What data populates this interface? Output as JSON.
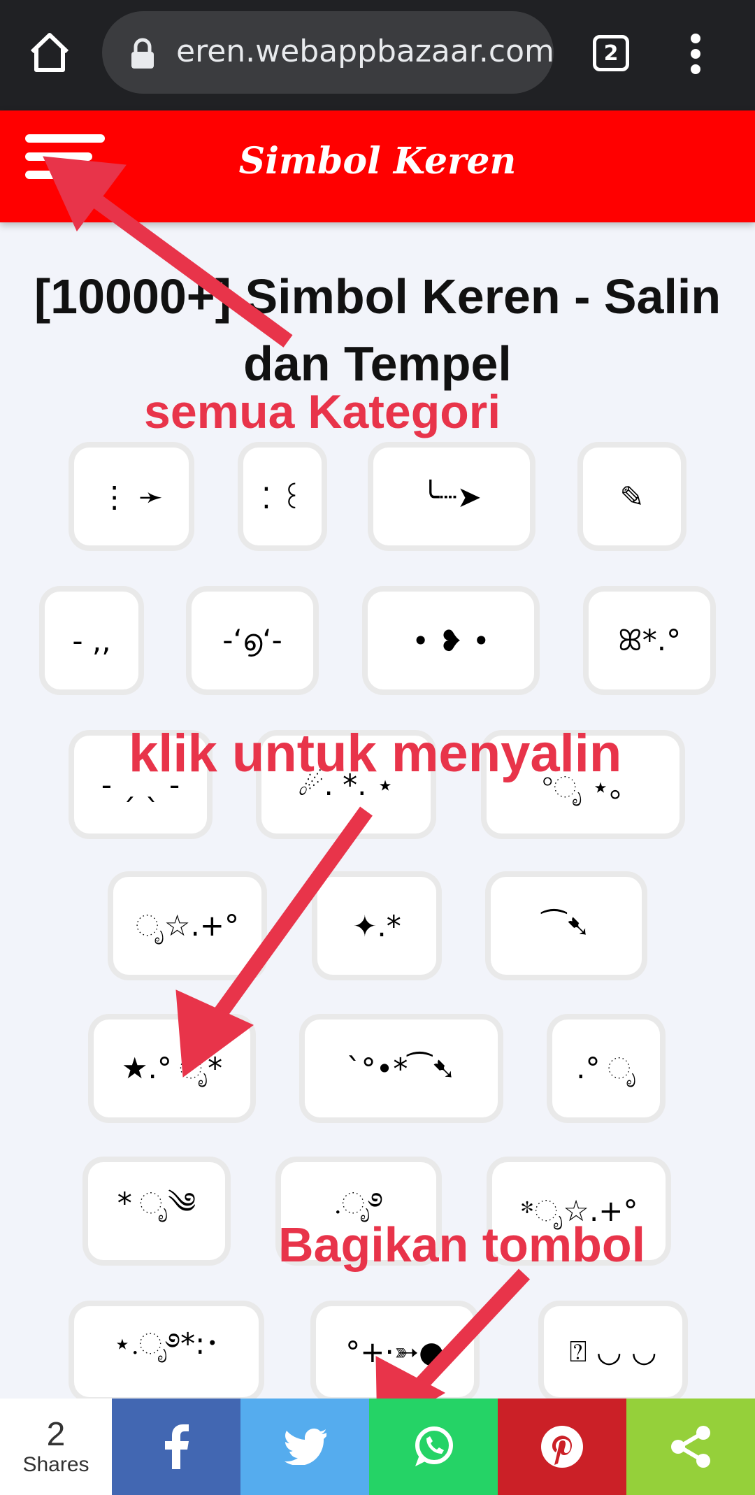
{
  "browser": {
    "url": "eren.webappbazaar.com",
    "tab_count": "2"
  },
  "header": {
    "brand": "Simbol Keren"
  },
  "page": {
    "title_line1": "[10000+] Simbol Keren - Salin",
    "title_line2": "dan Tempel"
  },
  "symbols": [
    "⋮ ➛",
    "⁚ ꒰",
    "╰┈➤",
    "✎",
    "- ,,",
    "-ʻ൭ʻ-",
    "• ❥ •",
    "ꕤ*.°",
    "- ˏ  ˎ -",
    "☄. *. ⋆",
    "°ೃ ⋆｡",
    "ೃ☆.+°",
    "✦.*",
    "⁀➷",
    "★.° ೃ*",
    "`°•*⁀➷",
    ".° ೃ",
    "* ೃ༄",
    ".ೃ࿔",
    "*ೃ☆.+°",
    "⋆.ೃ࿔*:･",
    "°+·➳●",
    "⍰ ◡ ◡"
  ],
  "annotations": {
    "categories": "semua Kategori",
    "click_copy": "klik untuk menyalin",
    "share_button": "Bagikan tombol"
  },
  "share_bar": {
    "count": "2",
    "count_label": "Shares",
    "colors": {
      "facebook": "#4267b2",
      "twitter": "#55acee",
      "whatsapp": "#25d366",
      "pinterest": "#cb2027",
      "share": "#95d03a"
    }
  }
}
